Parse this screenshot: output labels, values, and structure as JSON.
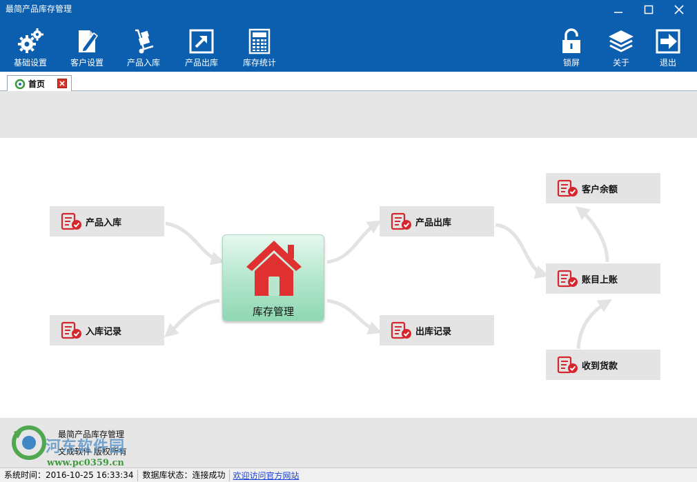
{
  "window": {
    "title": "最简产品库存管理",
    "controls": [
      {
        "name": "minimize",
        "icon": "minimize-icon"
      },
      {
        "name": "maximize",
        "icon": "maximize-icon"
      },
      {
        "name": "close",
        "icon": "close-icon"
      }
    ]
  },
  "toolbar": {
    "left": [
      {
        "label": "基础设置",
        "icon": "gears-icon"
      },
      {
        "label": "客户设置",
        "icon": "document-pen-icon"
      },
      {
        "label": "产品入库",
        "icon": "hand-truck-icon"
      },
      {
        "label": "产品出库",
        "icon": "export-arrow-icon"
      },
      {
        "label": "库存统计",
        "icon": "calculator-icon"
      }
    ],
    "right": [
      {
        "label": "锁屏",
        "icon": "padlock-icon"
      },
      {
        "label": "关于",
        "icon": "layers-icon"
      },
      {
        "label": "退出",
        "icon": "exit-icon"
      }
    ]
  },
  "tab": {
    "label": "首页",
    "icon": "home-tab-icon",
    "close_icon": "tab-close-icon"
  },
  "flow": {
    "center_label": "库存管理",
    "nodes": {
      "product_in": "产品入库",
      "in_records": "入库记录",
      "product_out": "产品出库",
      "out_records": "出库记录",
      "customer_balance": "客户余额",
      "ledger": "账目上账",
      "receive_payment": "收到货款"
    },
    "node_icon": "checklist-icon",
    "colors": {
      "node_icon": "#d4262c",
      "house": "#e0302f",
      "arrow": "#e6e6e6"
    }
  },
  "footer": {
    "app_name": "最简产品库存管理",
    "copyright": "文成软件  版权所有",
    "watermark_name": "河东软件园",
    "watermark_url": "www.pc0359.cn"
  },
  "statusbar": {
    "time": "系统时间：2016-10-25 16:33:34",
    "db_status": "数据库状态：连接成功",
    "link": "欢迎访问官方网站"
  },
  "theme": {
    "toolbar_bg": "#0c5fae",
    "band_bg": "#e6e6e6",
    "link": "#1a3fd8"
  }
}
